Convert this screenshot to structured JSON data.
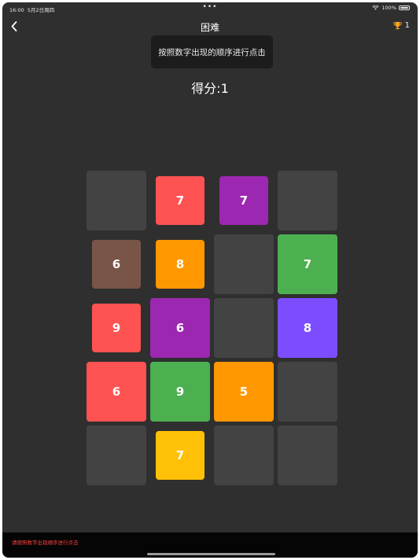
{
  "status": {
    "time": "16:00",
    "date": "5月2日周四",
    "dots": "•••",
    "battery": "100%"
  },
  "nav": {
    "title": "困难",
    "trophy_count": "1"
  },
  "hint": "按照数字出现的顺序进行点击",
  "score_text": "得分:1",
  "bottom_hint": "请按照数字出现顺序进行点击",
  "colors": {
    "background": "#2f2f2f",
    "empty_tile": "#434343",
    "red": "#ff5252",
    "purple": "#9c27b0",
    "brown": "#795548",
    "orange": "#ff9800",
    "green": "#4caf50",
    "violet": "#7c4dff",
    "yellow": "#ffc107",
    "trophy": "#f5a623"
  },
  "grid": [
    [
      {
        "value": "",
        "color": "empty"
      },
      {
        "value": "7",
        "color": "red"
      },
      {
        "value": "7",
        "color": "purple"
      },
      {
        "value": "",
        "color": "empty"
      }
    ],
    [
      {
        "value": "6",
        "color": "brown"
      },
      {
        "value": "8",
        "color": "orange"
      },
      {
        "value": "",
        "color": "empty"
      },
      {
        "value": "7",
        "color": "green"
      }
    ],
    [
      {
        "value": "9",
        "color": "red"
      },
      {
        "value": "6",
        "color": "purple"
      },
      {
        "value": "",
        "color": "empty"
      },
      {
        "value": "8",
        "color": "violet"
      }
    ],
    [
      {
        "value": "6",
        "color": "red"
      },
      {
        "value": "9",
        "color": "green"
      },
      {
        "value": "5",
        "color": "orange"
      },
      {
        "value": "",
        "color": "empty"
      }
    ],
    [
      {
        "value": "",
        "color": "empty"
      },
      {
        "value": "7",
        "color": "yellow"
      },
      {
        "value": "",
        "color": "empty"
      },
      {
        "value": "",
        "color": "empty"
      }
    ]
  ]
}
